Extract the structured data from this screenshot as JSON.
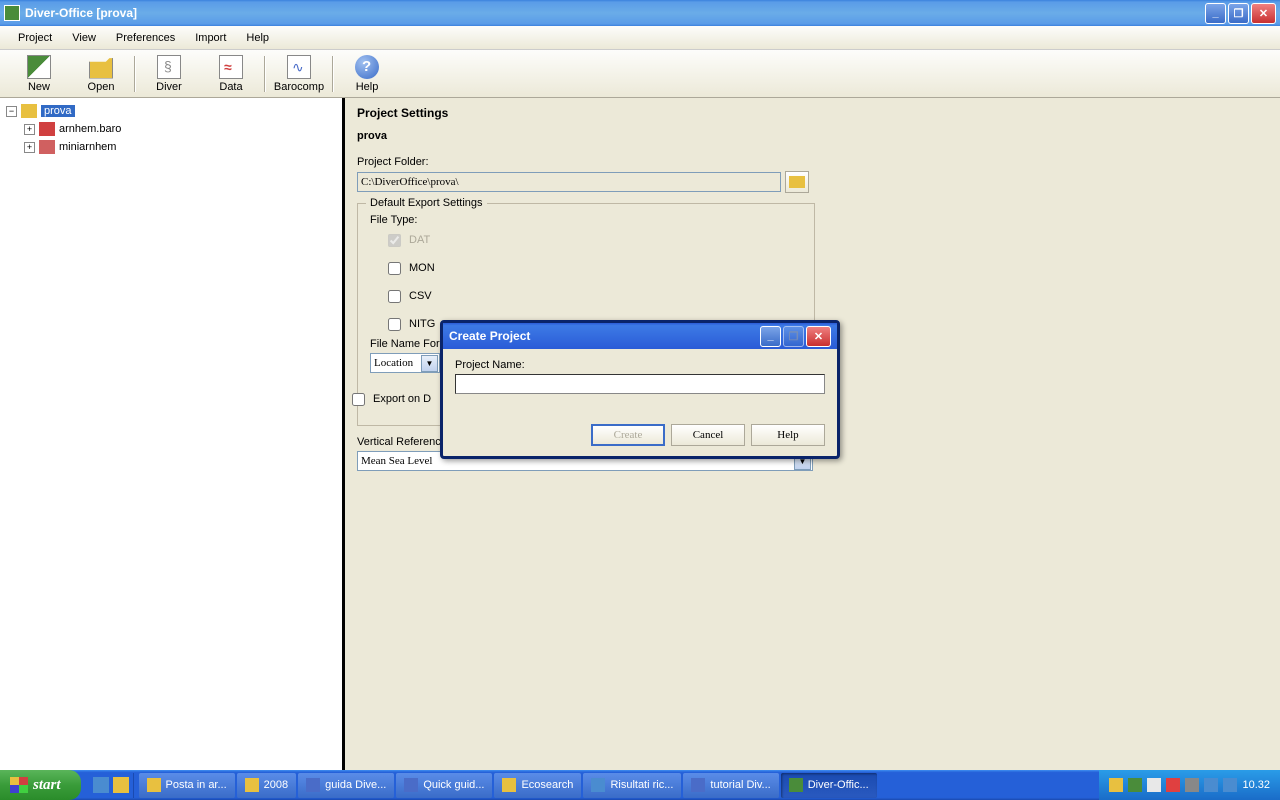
{
  "window": {
    "title": "Diver-Office [prova]"
  },
  "menu": {
    "project": "Project",
    "view": "View",
    "preferences": "Preferences",
    "import": "Import",
    "help": "Help"
  },
  "toolbar": {
    "new": "New",
    "open": "Open",
    "diver": "Diver",
    "data": "Data",
    "barocomp": "Barocomp",
    "help": "Help"
  },
  "tree": {
    "root": "prova",
    "items": [
      {
        "label": "arnhem.baro"
      },
      {
        "label": "miniarnhem"
      }
    ]
  },
  "settings": {
    "heading": "Project Settings",
    "name": "prova",
    "folder_label": "Project Folder:",
    "folder_value": "C:\\DiverOffice\\prova\\",
    "export_group": "Default Export Settings",
    "file_type_label": "File Type:",
    "opt_dat": "DAT",
    "opt_mon": "MON",
    "opt_csv": "CSV",
    "opt_nitg": "NITG",
    "fname_label": "File Name Form",
    "fname_value": "Location",
    "export_on_d": "Export on D",
    "vrd_label": "Vertical Reference Datum:",
    "vrd_value": "Mean Sea Level"
  },
  "dialog": {
    "title": "Create Project",
    "name_label": "Project Name:",
    "name_value": "",
    "create": "Create",
    "cancel": "Cancel",
    "help": "Help"
  },
  "taskbar": {
    "start": "start",
    "items": [
      {
        "label": "Posta in ar..."
      },
      {
        "label": "2008"
      },
      {
        "label": "guida Dive..."
      },
      {
        "label": "Quick guid..."
      },
      {
        "label": "Ecosearch"
      },
      {
        "label": "Risultati ric..."
      },
      {
        "label": "tutorial Div..."
      },
      {
        "label": "Diver-Offic...",
        "active": true
      }
    ],
    "clock": "10.32"
  }
}
